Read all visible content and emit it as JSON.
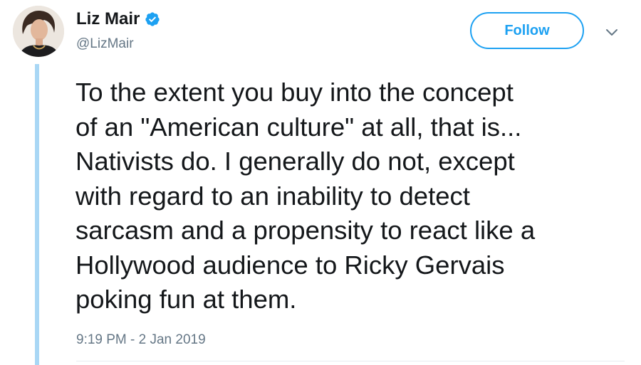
{
  "author": {
    "display_name": "Liz Mair",
    "handle": "@LizMair",
    "verified": true,
    "avatar_icon": "profile-photo"
  },
  "actions": {
    "follow_label": "Follow",
    "more_icon": "chevron-down-icon"
  },
  "tweet": {
    "lines": [
      "To the extent you buy into the concept",
      "of an \"American culture\" at all, that is...",
      "Nativists do. I generally do not, except",
      "with regard to an inability to detect",
      "sarcasm and a propensity to react like a",
      "Hollywood audience to Ricky Gervais",
      "poking fun at them."
    ],
    "timestamp": "9:19 PM - 2 Jan 2019"
  },
  "colors": {
    "accent": "#1da1f2",
    "thread_line": "#a9d7f5",
    "secondary_text": "#657786",
    "primary_text": "#14171a"
  }
}
